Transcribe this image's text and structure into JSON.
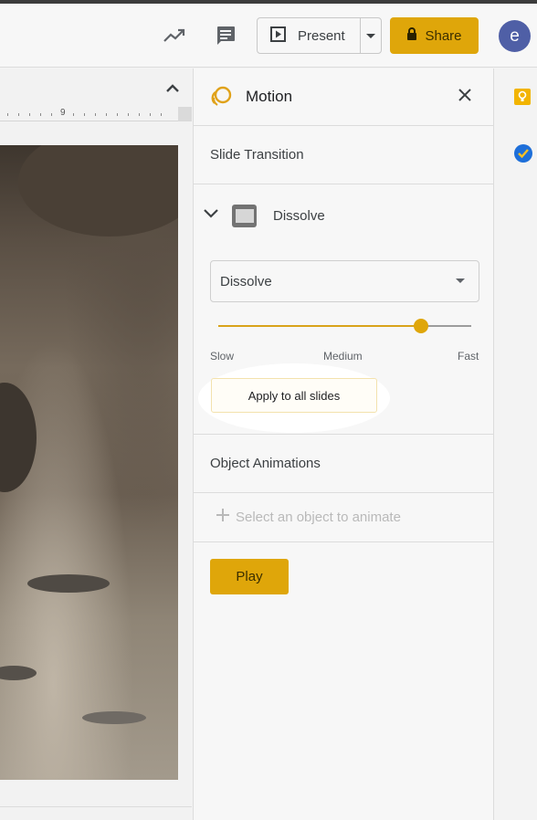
{
  "header": {
    "present_label": "Present",
    "share_label": "Share",
    "avatar_initial": "e",
    "icons": [
      "trending-icon",
      "comment-icon",
      "present-play-icon",
      "chevron-down-icon",
      "lock-icon"
    ]
  },
  "canvas": {
    "ruler_number": "9"
  },
  "panel": {
    "title": "Motion",
    "slide_transition_title": "Slide Transition",
    "transition_name": "Dissolve",
    "transition_select_value": "Dissolve",
    "speed_value": 0.8,
    "speed_labels": {
      "slow": "Slow",
      "medium": "Medium",
      "fast": "Fast"
    },
    "apply_label": "Apply to all slides",
    "object_animations_title": "Object Animations",
    "select_object_label": "Select an object to animate",
    "play_label": "Play"
  },
  "colors": {
    "accent": "#dfa60a",
    "avatar": "#4f5fa6"
  }
}
